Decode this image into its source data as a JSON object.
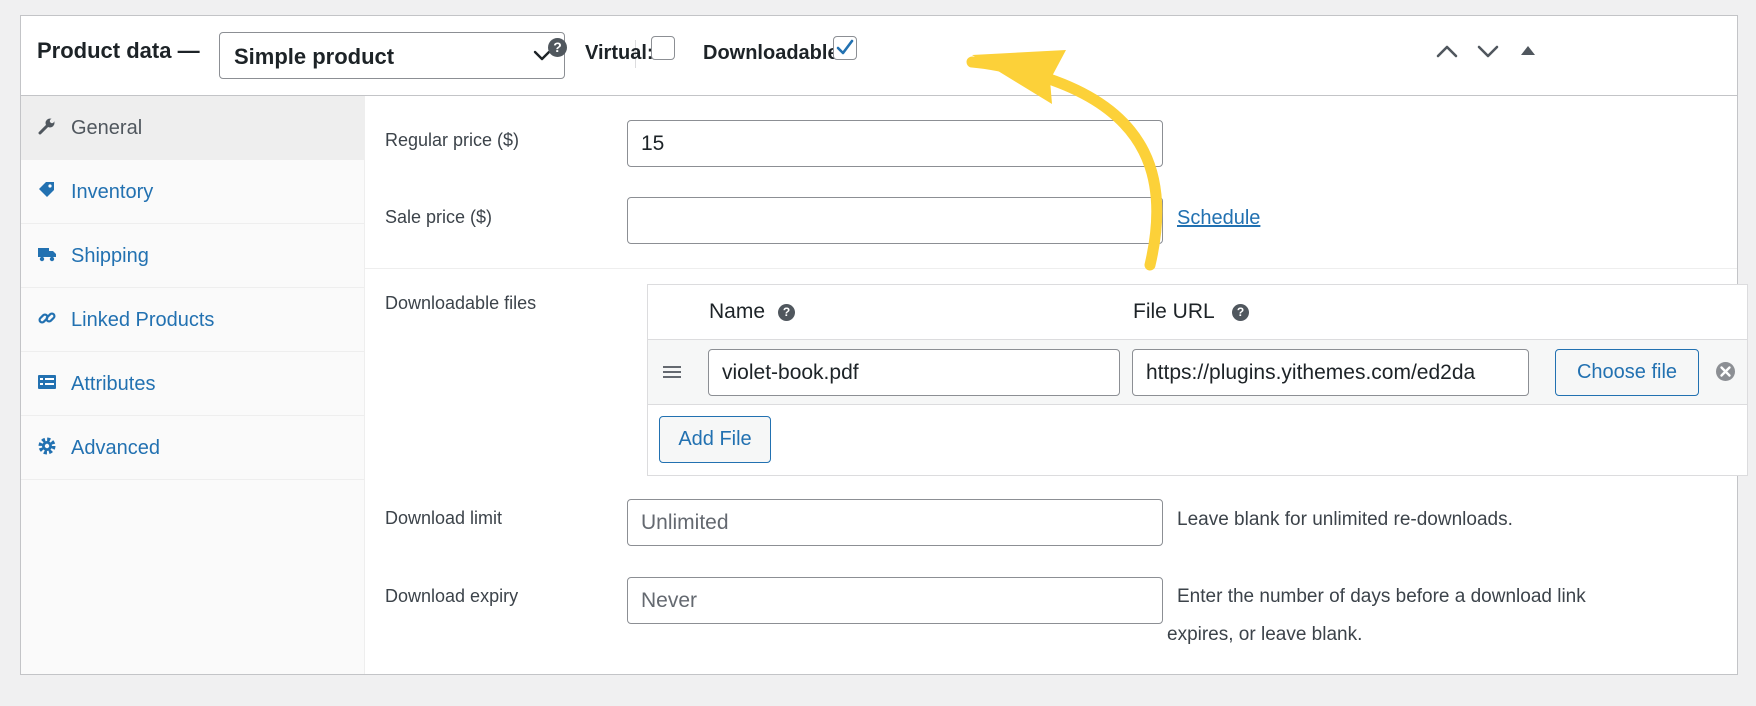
{
  "header": {
    "title": "Product data —",
    "product_type": {
      "selected": "Simple product"
    },
    "help_glyph": "?",
    "virtual": {
      "label": "Virtual:",
      "checked": false
    },
    "downloadable": {
      "label": "Downloadable:",
      "checked": true
    },
    "icons": [
      "chevron-up-icon",
      "chevron-down-icon",
      "panel-toggle-arrow-icon"
    ]
  },
  "sidebar": {
    "items": [
      {
        "label": "General",
        "icon": "wrench-icon",
        "active": true
      },
      {
        "label": "Inventory",
        "icon": "tag-icon",
        "active": false
      },
      {
        "label": "Shipping",
        "icon": "truck-icon",
        "active": false
      },
      {
        "label": "Linked Products",
        "icon": "link-icon",
        "active": false
      },
      {
        "label": "Attributes",
        "icon": "list-icon",
        "active": false
      },
      {
        "label": "Advanced",
        "icon": "gear-icon",
        "active": false
      }
    ]
  },
  "general": {
    "regular_price": {
      "label": "Regular price ($)",
      "value": "15"
    },
    "sale_price": {
      "label": "Sale price ($)",
      "value": "",
      "schedule_link": "Schedule"
    },
    "downloadable_files": {
      "label": "Downloadable files",
      "columns": {
        "name": "Name",
        "file_url": "File URL"
      },
      "rows": [
        {
          "name": "violet-book.pdf",
          "file_url": "https://plugins.yithemes.com/ed2da",
          "choose_label": "Choose file"
        }
      ],
      "add_label": "Add File"
    },
    "download_limit": {
      "label": "Download limit",
      "placeholder": "Unlimited",
      "desc": "Leave blank for unlimited re-downloads."
    },
    "download_expiry": {
      "label": "Download expiry",
      "placeholder": "Never",
      "desc_line1": "Enter the number of days before a download link",
      "desc_line2": "expires, or leave blank."
    }
  },
  "annotation": {
    "arrow_color": "#fcd139"
  },
  "colors": {
    "link": "#2271b1",
    "checkbox_check": "#2271b1",
    "annotation_arrow": "#fcd139"
  }
}
